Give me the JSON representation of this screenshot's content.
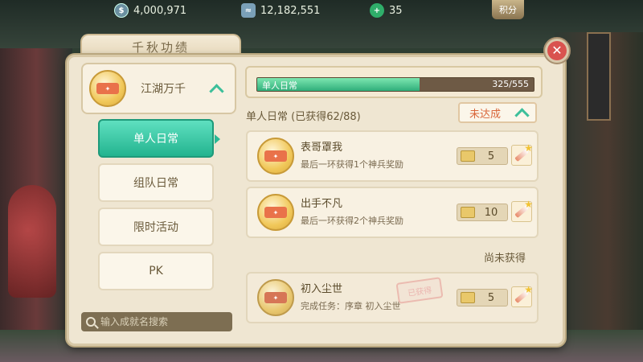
{
  "resources": {
    "coins": "4,000,971",
    "silver": "12,182,551",
    "jade": "35",
    "score_label": "积分"
  },
  "panel": {
    "title": "千秋功绩",
    "close_symbol": "✕"
  },
  "category": {
    "name": "江湖万千"
  },
  "menu": {
    "items": [
      {
        "label": "单人日常",
        "active": true
      },
      {
        "label": "组队日常",
        "active": false
      },
      {
        "label": "限时活动",
        "active": false
      },
      {
        "label": "PK",
        "active": false
      }
    ]
  },
  "search": {
    "placeholder": "输入成就名搜索"
  },
  "progress": {
    "label": "单人日常",
    "count": "325/555",
    "fraction": 0.586
  },
  "section": {
    "title": "单人日常  (已获得62/88)",
    "filter_label": "未达成"
  },
  "achievements": [
    {
      "title": "表哥罩我",
      "desc": "最后一环获得1个神兵奖励",
      "reward": "5"
    },
    {
      "title": "出手不凡",
      "desc": "最后一环获得2个神兵奖励",
      "reward": "10"
    },
    {
      "title": "初入尘世",
      "desc": "完成任务：序章 初入尘世",
      "reward": "5",
      "stamp": "已获得"
    }
  ],
  "unearned_label": "尚未获得",
  "colors": {
    "accent": "#23b48f",
    "panel_bg": "#efe6d2",
    "close_red": "#d9534f",
    "filter_text": "#d9663a"
  }
}
